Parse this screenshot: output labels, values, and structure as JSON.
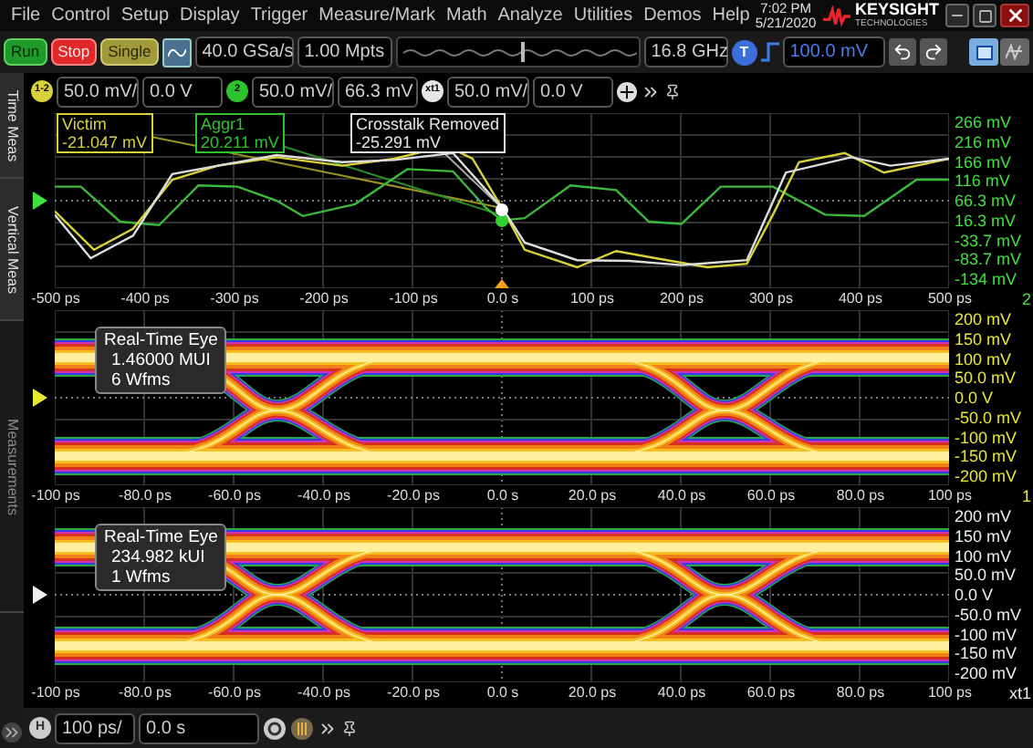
{
  "menu": [
    "File",
    "Control",
    "Setup",
    "Display",
    "Trigger",
    "Measure/Mark",
    "Math",
    "Analyze",
    "Utilities",
    "Demos",
    "Help"
  ],
  "clock": {
    "time": "7:02 PM",
    "date": "5/21/2020"
  },
  "logo": {
    "name": "KEYSIGHT",
    "sub": "TECHNOLOGIES"
  },
  "toolbar": {
    "buttons": [
      {
        "label": "Run",
        "kind": "run"
      },
      {
        "label": "Stop",
        "kind": "stop"
      },
      {
        "label": "Single",
        "kind": "single"
      }
    ],
    "sample_rate": "40.0 GSa/s",
    "memory_depth": "1.00 Mpts",
    "bandwidth_slider": {
      "level": 0.52
    },
    "bandwidth": "16.8 GHz",
    "trigger_badge": "T",
    "trigger_level": "100.0 mV"
  },
  "channels": [
    {
      "badge": "1-2",
      "color": "#d8d23a",
      "scale": "50.0 mV/",
      "offset": "0.0 V"
    },
    {
      "badge": "2",
      "color": "#2fc22f",
      "scale": "50.0 mV/",
      "offset": "66.3 mV"
    },
    {
      "badge": "xt1",
      "color": "#e6e6e6",
      "scale": "50.0 mV/",
      "offset": "0.0 V"
    }
  ],
  "side_tabs": [
    {
      "label": "Time Meas",
      "disabled": false
    },
    {
      "label": "Vertical Meas",
      "disabled": false
    },
    {
      "label": "Measurements",
      "disabled": true
    }
  ],
  "panels": [
    {
      "kind": "waveform",
      "color": "#3fe03f",
      "tag": "2",
      "y_labels": [
        "266 mV",
        "216 mV",
        "166 mV",
        "116 mV",
        "66.3 mV",
        "16.3 mV",
        "-33.7 mV",
        "-83.7 mV",
        "-134 mV"
      ],
      "x_labels": [
        "-500 ps",
        "-400 ps",
        "-300 ps",
        "-200 ps",
        "-100 ps",
        "0.0 s",
        "100 ps",
        "200 ps",
        "300 ps",
        "400 ps",
        "500 ps"
      ],
      "markers": [
        {
          "title": "Victim",
          "value": "-21.047 mV",
          "color": "#d8d23a"
        },
        {
          "title": "Aggr1",
          "value": "20.211 mV",
          "color": "#2fc22f"
        },
        {
          "title": "Crosstalk Removed",
          "value": "-25.291 mV",
          "color": "#e6e6e6"
        }
      ]
    },
    {
      "kind": "eye",
      "color": "#e8e832",
      "tag": "1",
      "y_labels": [
        "200 mV",
        "150 mV",
        "100 mV",
        "50.0 mV",
        "0.0 V",
        "-50.0 mV",
        "-100 mV",
        "-150 mV",
        "-200 mV"
      ],
      "x_labels": [
        "-100 ps",
        "-80.0 ps",
        "-60.0 ps",
        "-40.0 ps",
        "-20.0 ps",
        "0.0 s",
        "20.0 ps",
        "40.0 ps",
        "60.0 ps",
        "80.0 ps",
        "100 ps"
      ],
      "info": {
        "title": "Real-Time Eye",
        "lines": [
          "1.46000 MUI",
          "6 Wfms"
        ]
      }
    },
    {
      "kind": "eye",
      "color": "#eeeeee",
      "tag": "xt1",
      "y_labels": [
        "200 mV",
        "150 mV",
        "100 mV",
        "50.0 mV",
        "0.0 V",
        "-50.0 mV",
        "-100 mV",
        "-150 mV",
        "-200 mV"
      ],
      "x_labels": [
        "-100 ps",
        "-80.0 ps",
        "-60.0 ps",
        "-40.0 ps",
        "-20.0 ps",
        "0.0 s",
        "20.0 ps",
        "40.0 ps",
        "60.0 ps",
        "80.0 ps",
        "100 ps"
      ],
      "info": {
        "title": "Real-Time Eye",
        "lines": [
          "234.982 kUI",
          "1 Wfms"
        ]
      }
    }
  ],
  "horizontal": {
    "badge": "H",
    "scale": "100 ps/",
    "position": "0.0 s"
  }
}
